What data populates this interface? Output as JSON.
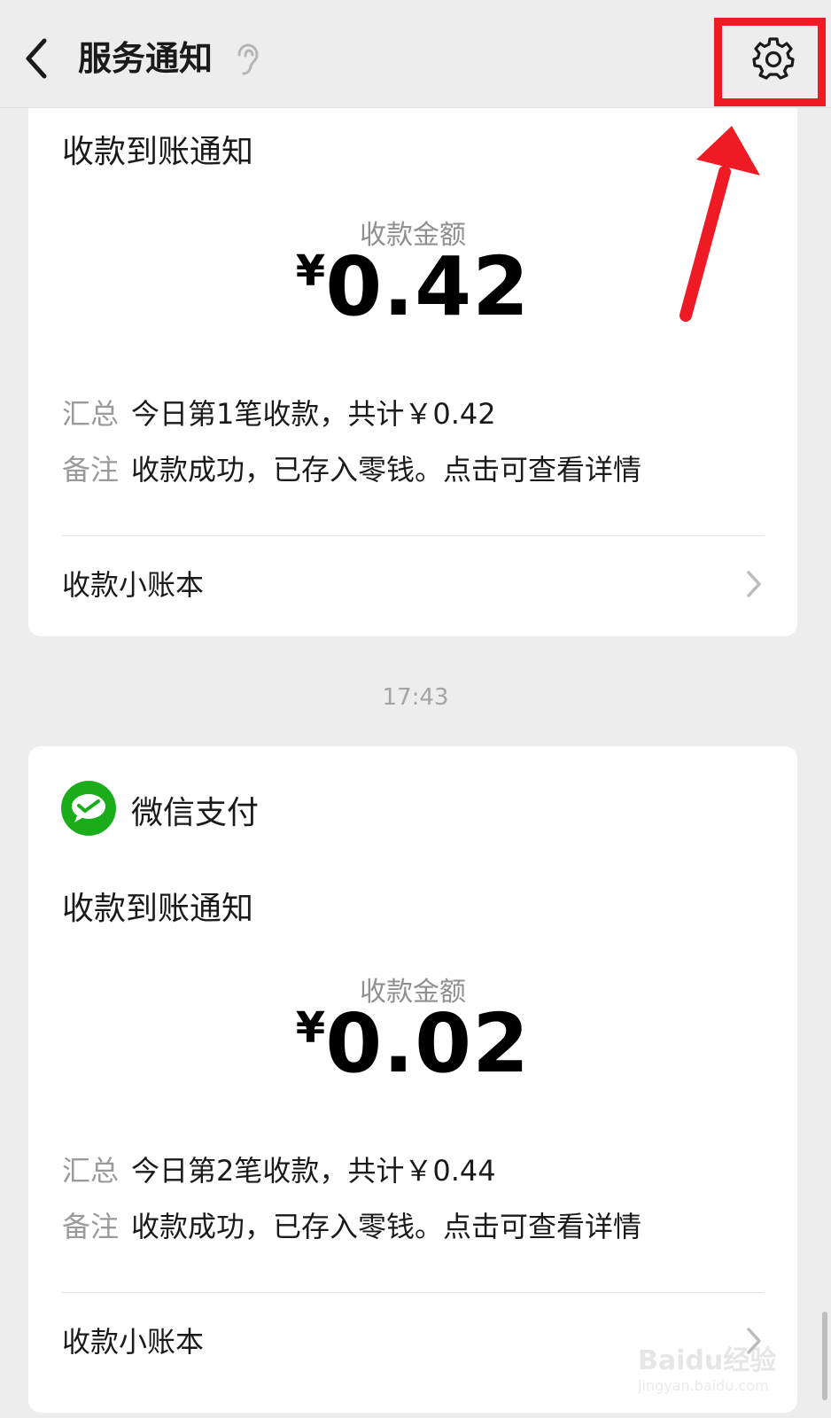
{
  "header": {
    "title": "服务通知"
  },
  "cards": [
    {
      "notice_title": "收款到账通知",
      "amount_label": "收款金额",
      "currency": "¥",
      "amount": "0.42",
      "summary_key": "汇总",
      "summary_value": "今日第1笔收款，共计￥0.42",
      "remark_key": "备注",
      "remark_value": "收款成功，已存入零钱。点击可查看详情",
      "ledger_label": "收款小账本"
    },
    {
      "sender": "微信支付",
      "notice_title": "收款到账通知",
      "amount_label": "收款金额",
      "currency": "¥",
      "amount": "0.02",
      "summary_key": "汇总",
      "summary_value": "今日第2笔收款，共计￥0.44",
      "remark_key": "备注",
      "remark_value": "收款成功，已存入零钱。点击可查看详情",
      "ledger_label": "收款小账本"
    }
  ],
  "timestamp": "17:43",
  "watermark": {
    "brand": "Baidu经验",
    "url": "jingyan.baidu.com"
  },
  "colors": {
    "background": "#ededed",
    "card": "#ffffff",
    "highlight": "#ee1b24",
    "wechat_green": "#1aad19"
  },
  "icons": {
    "back": "chevron-left-icon",
    "voice": "ear-icon",
    "settings": "gear-icon",
    "ledger": "chevron-right-icon",
    "sender": "wechat-pay-logo-icon"
  }
}
